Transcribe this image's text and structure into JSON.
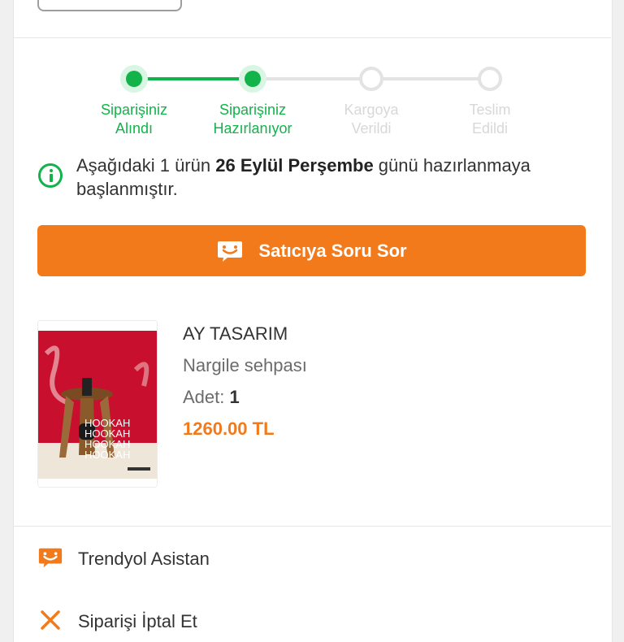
{
  "stepper": {
    "steps": [
      {
        "label": "Siparişiniz\nAlındı",
        "status": "done"
      },
      {
        "label": "Siparişiniz\nHazırlanıyor",
        "status": "done"
      },
      {
        "label": "Kargoya\nVerildi",
        "status": "todo"
      },
      {
        "label": "Teslim\nEdildi",
        "status": "todo"
      }
    ]
  },
  "info": {
    "icon": "info-icon",
    "text_before": "Aşağıdaki 1 ürün ",
    "text_bold": "26 Eylül Perşembe",
    "text_after": " günü hazırlanmaya başlanmıştır."
  },
  "ask_button": {
    "label": "Satıcıya Soru Sor",
    "icon": "chat-icon"
  },
  "product": {
    "brand": "AY TASARIM",
    "name": "Nargile sehpası",
    "qty_label": "Adet:",
    "qty_value": "1",
    "price": "1260.00 TL",
    "image_text": [
      "HOOKAH",
      "HOOKAH",
      "HOOKAH",
      "HOOKAH"
    ]
  },
  "actions": [
    {
      "label": "Trendyol Asistan",
      "icon": "assistant-chat-icon"
    },
    {
      "label": "Siparişi İptal Et",
      "icon": "cancel-x-icon"
    }
  ],
  "colors": {
    "green": "#12b34a",
    "orange": "#f27a1a"
  }
}
